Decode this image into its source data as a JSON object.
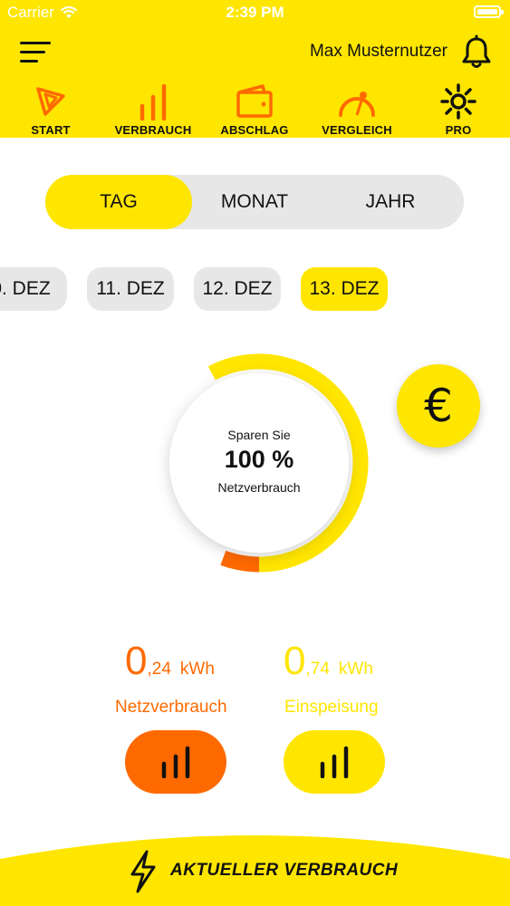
{
  "status_bar": {
    "carrier": "Carrier",
    "time": "2:39 PM"
  },
  "header": {
    "user_name": "Max Musternutzer"
  },
  "nav": {
    "items": [
      {
        "label": "START"
      },
      {
        "label": "VERBRAUCH"
      },
      {
        "label": "ABSCHLAG"
      },
      {
        "label": "VERGLEICH"
      },
      {
        "label": "PRO"
      }
    ]
  },
  "period_tabs": {
    "items": [
      "TAG",
      "MONAT",
      "JAHR"
    ],
    "selected": "TAG"
  },
  "dates": {
    "items": [
      "0. DEZ",
      "11. DEZ",
      "12. DEZ",
      "13. DEZ"
    ],
    "selected": "13. DEZ"
  },
  "gauge": {
    "line1": "Sparen Sie",
    "value": "100 %",
    "line3": "Netzverbrauch",
    "netz_fraction": 0.24,
    "einspeisung_fraction": 0.74
  },
  "euro_button": {
    "symbol": "€"
  },
  "stats": {
    "netz": {
      "int": "0",
      "dec": ",24",
      "unit": "kWh",
      "label": "Netzverbrauch"
    },
    "einspeisung": {
      "int": "0",
      "dec": ",74",
      "unit": "kWh",
      "label": "Einspeisung"
    }
  },
  "bottom": {
    "label": "AKTUELLER VERBRAUCH"
  },
  "colors": {
    "yellow": "#FFE600",
    "orange": "#FF6A00",
    "grey": "#e7e7e7"
  }
}
